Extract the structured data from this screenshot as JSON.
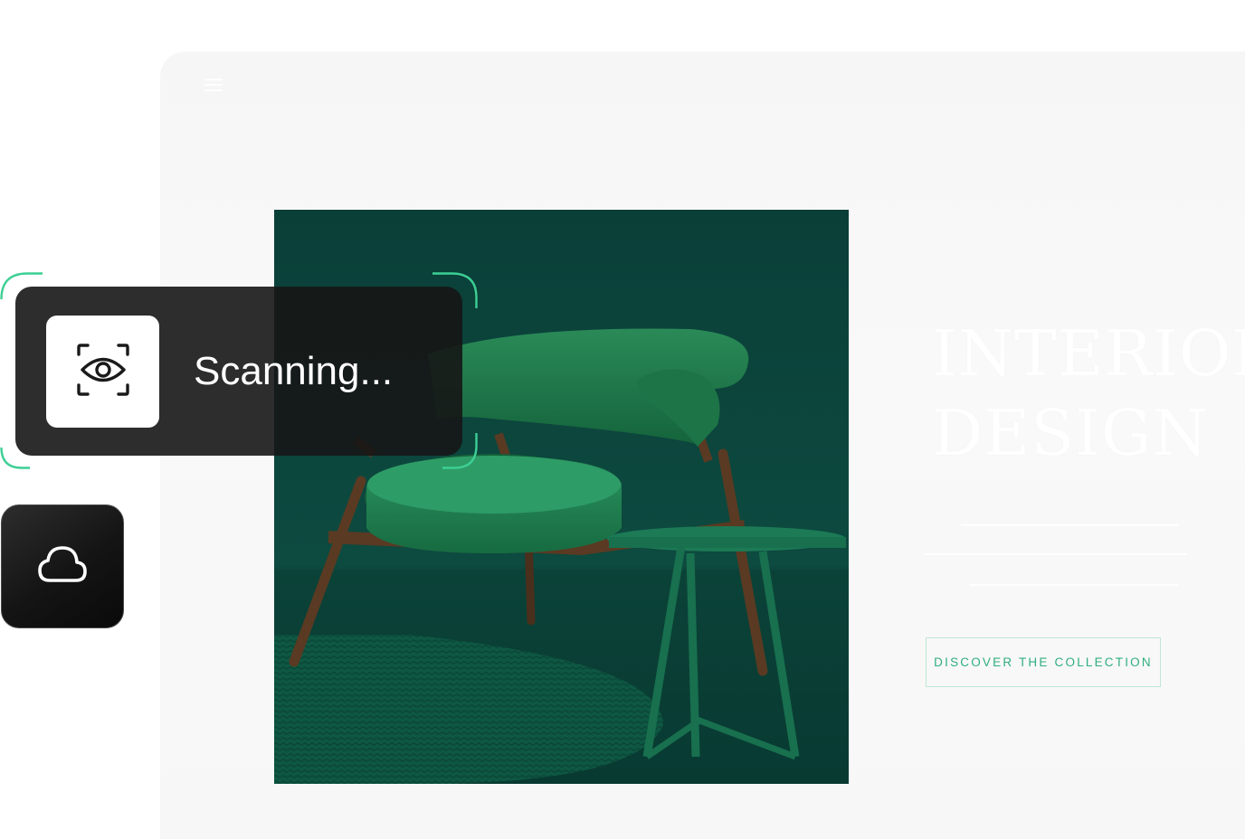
{
  "site": {
    "menu_icon": "hamburger-menu-icon",
    "headline_line1": "INTERIOR",
    "headline_line2": "DESIGN",
    "cta_label": "DISCOVER THE COLLECTION",
    "hero_image": "green velvet armchair with round side table",
    "colors": {
      "accent": "#2fae7f",
      "cta_border": "#bfe6d4",
      "hero_bg": "#0d4a40",
      "chair": "#1f7a4a"
    }
  },
  "scan_overlay": {
    "icon": "eye-scan-icon",
    "status_text": "Scanning...",
    "colors": {
      "panel": "#161616",
      "frame": "#3ccf95"
    }
  },
  "cloud_button": {
    "icon": "cloud-icon"
  }
}
